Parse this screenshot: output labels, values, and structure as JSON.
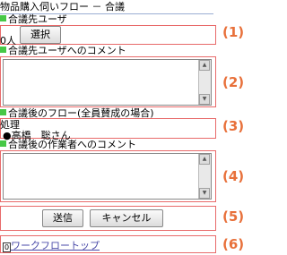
{
  "page_title": "物品購入伺いフロー － 合議",
  "sections": {
    "s1_label": "合議先ユーザ",
    "s1_count": "0人",
    "s1_button": "選択",
    "s2_label": "合議先ユーザへのコメント",
    "s3_label": "合議後のフロー(全員賛成の場合)",
    "s3_action": "処理",
    "s3_person": "●高橋　聡さん",
    "s4_label": "合議後の作業者へのコメント"
  },
  "buttons": {
    "submit": "送信",
    "cancel": "キャンセル"
  },
  "footer": {
    "icon": "0",
    "link": "ワークフロートップ"
  },
  "callouts": [
    "(1)",
    "(2)",
    "(3)",
    "(4)",
    "(5)",
    "(6)"
  ],
  "colors": {
    "callout": "#e8703a",
    "callout_box": "#e86a6a",
    "section_marker": "#46c846",
    "link": "#4a4aa8"
  }
}
